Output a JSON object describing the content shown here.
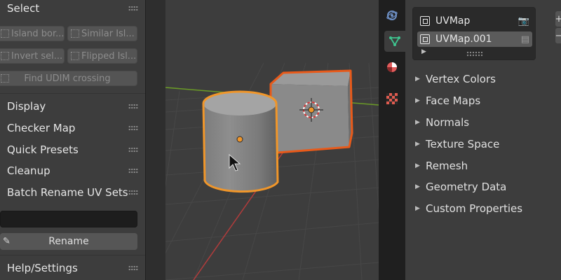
{
  "left_panel": {
    "headers": {
      "select": "Select",
      "display": "Display",
      "checker_map": "Checker Map",
      "quick_presets": "Quick Presets",
      "cleanup": "Cleanup",
      "batch_rename": "Batch Rename UV Sets",
      "help_settings": "Help/Settings"
    },
    "tools": {
      "island_borders": "Island bor...",
      "similar_islands": "Similar Isl...",
      "invert_selection": "Invert sel...",
      "flipped_islands": "Flipped Isl...",
      "find_udim_crossing": "Find UDIM crossing"
    },
    "rename_field_value": "",
    "rename_label": "Rename"
  },
  "properties": {
    "uv_maps": [
      "UVMap",
      "UVMap.001"
    ],
    "selected_uv_map": "UVMap.001",
    "subpanels": [
      "Vertex Colors",
      "Face Maps",
      "Normals",
      "Texture Space",
      "Remesh",
      "Geometry Data",
      "Custom Properties"
    ]
  },
  "tabs": [
    "physics-icon",
    "mesh-data-icon",
    "material-icon",
    "texture-icon"
  ],
  "colors": {
    "selection_outline": "#e87d1e",
    "active_tab_mesh": "#3ec48f",
    "x_axis": "#b13c3c",
    "y_axis": "#6b9b27"
  }
}
